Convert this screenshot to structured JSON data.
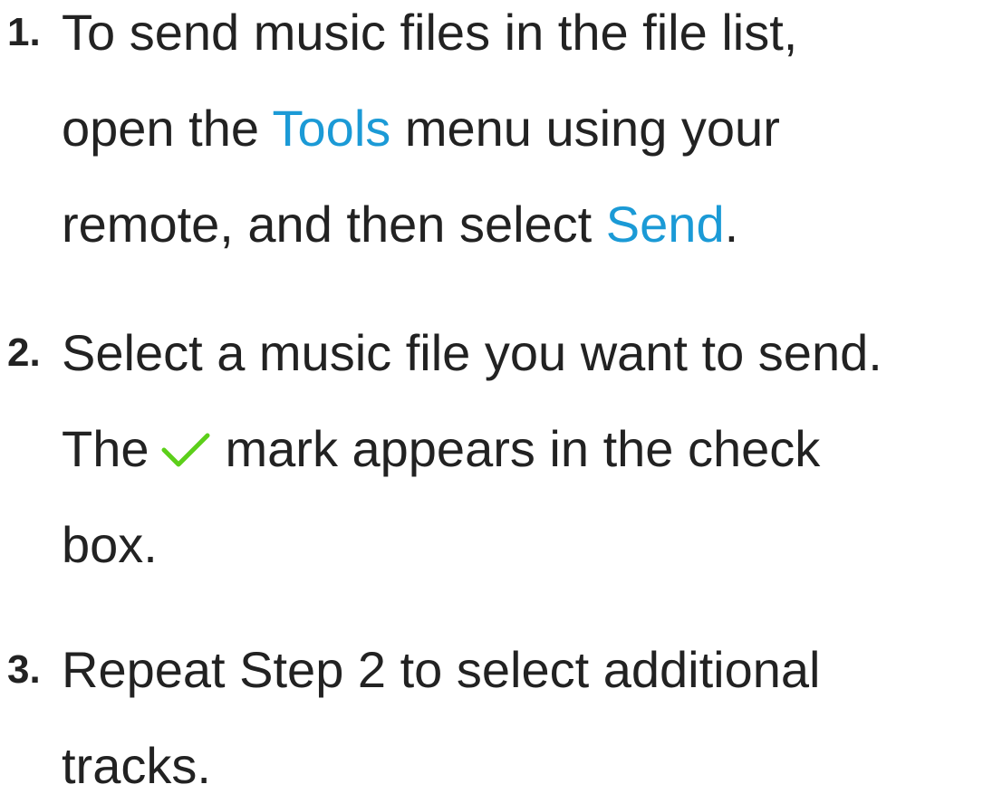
{
  "steps": [
    {
      "number": "1.",
      "lines": [
        "To send music files in the file list,",
        {
          "before": "open the ",
          "highlight": "Tools",
          "after": " menu using your"
        },
        {
          "before": "remote, and then select ",
          "highlight": "Send",
          "after": "."
        }
      ]
    },
    {
      "number": "2.",
      "lines": [
        "Select a music file you want to send.",
        {
          "before": "The",
          "icon": "check-icon",
          "after": "mark appears in the check"
        },
        "box."
      ]
    },
    {
      "number": "3.",
      "lines": [
        "Repeat Step 2 to select additional",
        "tracks."
      ]
    }
  ],
  "colors": {
    "text": "#222222",
    "highlight": "#1b9ad6",
    "check": "#5ccf1a"
  }
}
